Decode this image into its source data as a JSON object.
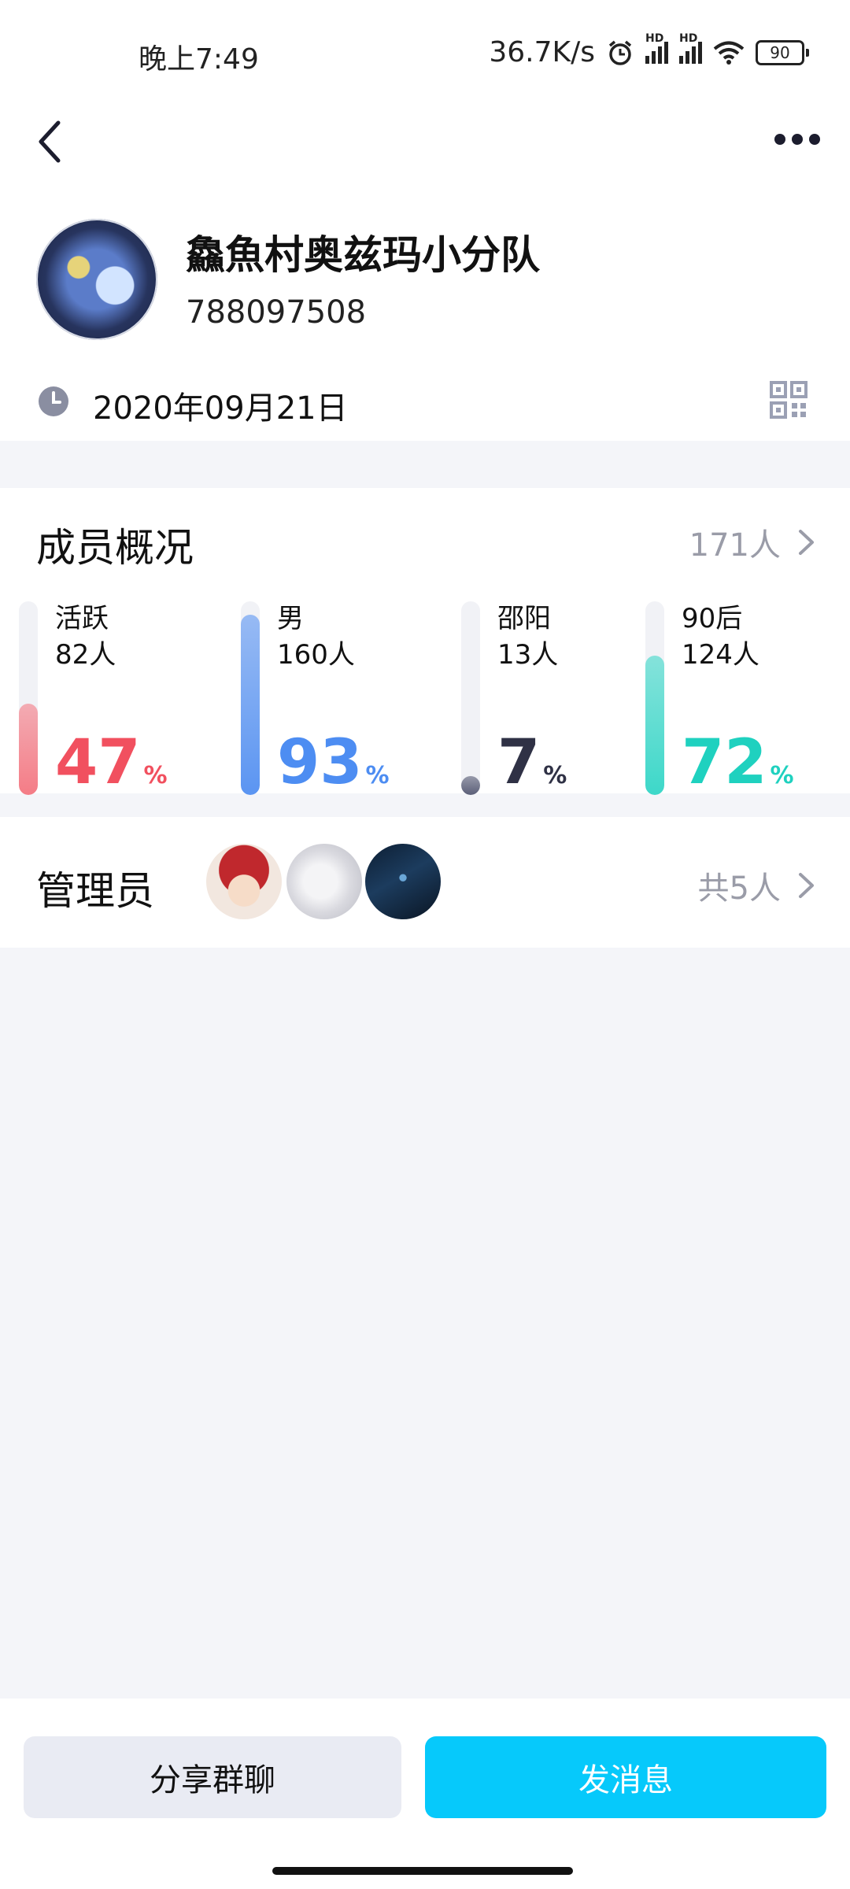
{
  "status_bar": {
    "time": "晚上7:49",
    "net_speed": "36.7K/s",
    "hd1": "HD",
    "hd2": "HD",
    "battery": "90"
  },
  "group": {
    "name": "鱻魚村奥兹玛小分队",
    "id": "788097508",
    "created_date": "2020年09月21日"
  },
  "members": {
    "title": "成员概况",
    "total": "171人",
    "stats": [
      {
        "label": "活跃",
        "count": "82人",
        "percent": "47",
        "unit": "%",
        "fraction": 0.47,
        "color": "#f1505f",
        "fill": "#f47c86"
      },
      {
        "label": "男",
        "count": "160人",
        "percent": "93",
        "unit": "%",
        "fraction": 0.93,
        "color": "#4d8df2",
        "fill": "#5b95f2"
      },
      {
        "label": "邵阳",
        "count": "13人",
        "percent": "7",
        "unit": "%",
        "fraction": 0.07,
        "color": "#2f3145",
        "fill": "#5b5f78"
      },
      {
        "label": "90后",
        "count": "124人",
        "percent": "72",
        "unit": "%",
        "fraction": 0.72,
        "color": "#1fd1bf",
        "fill": "#3dd8c9"
      }
    ]
  },
  "admins": {
    "title": "管理员",
    "count": "共5人"
  },
  "buttons": {
    "share": "分享群聊",
    "message": "发消息"
  },
  "colors": {
    "primary": "#06c9fb",
    "background": "#f4f5f9"
  }
}
